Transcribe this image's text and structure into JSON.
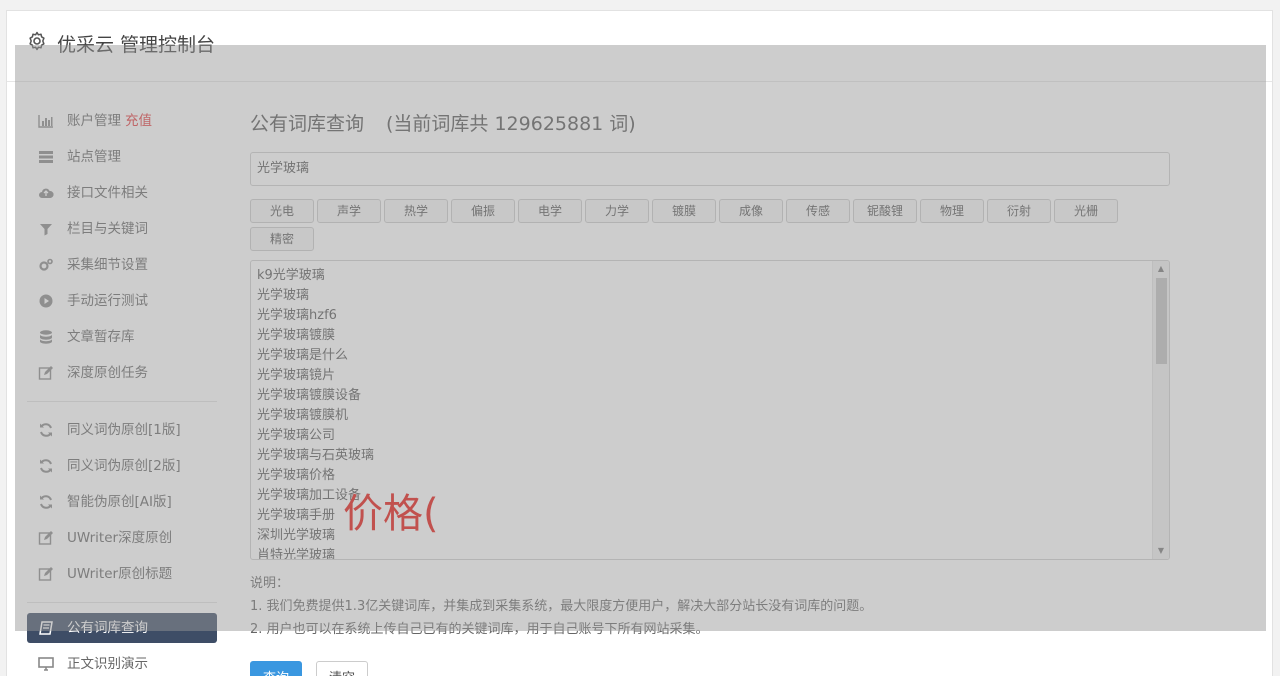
{
  "header": {
    "title": "优采云 管理控制台",
    "icon": "gear-icon"
  },
  "sidebar": {
    "group1": [
      {
        "label": "账户管理",
        "badge": "充值",
        "icon": "bar-chart-icon"
      },
      {
        "label": "站点管理",
        "icon": "server-icon"
      },
      {
        "label": "接口文件相关",
        "icon": "cloud-upload-icon"
      },
      {
        "label": "栏目与关键词",
        "icon": "filter-icon"
      },
      {
        "label": "采集细节设置",
        "icon": "gears-icon"
      },
      {
        "label": "手动运行测试",
        "icon": "play-circle-icon"
      },
      {
        "label": "文章暂存库",
        "icon": "database-icon"
      },
      {
        "label": "深度原创任务",
        "icon": "edit-icon"
      }
    ],
    "group2": [
      {
        "label": "同义词伪原创[1版]",
        "icon": "refresh-icon"
      },
      {
        "label": "同义词伪原创[2版]",
        "icon": "refresh-icon"
      },
      {
        "label": "智能伪原创[AI版]",
        "icon": "refresh-icon"
      },
      {
        "label": "UWriter深度原创",
        "icon": "edit-icon"
      },
      {
        "label": "UWriter原创标题",
        "icon": "edit-icon"
      }
    ],
    "group3": [
      {
        "label": "公有词库查询",
        "icon": "book-icon",
        "active": true
      },
      {
        "label": "正文识别演示",
        "icon": "desktop-icon"
      }
    ]
  },
  "main": {
    "title": "公有词库查询",
    "count_text": "(当前词库共 129625881 词)",
    "search_value": "光学玻璃",
    "tags": [
      "光电",
      "声学",
      "热学",
      "偏振",
      "电学",
      "力学",
      "镀膜",
      "成像",
      "传感",
      "铌酸锂",
      "物理",
      "衍射",
      "光栅",
      "精密"
    ],
    "results": [
      "k9光学玻璃",
      "光学玻璃",
      "光学玻璃hzf6",
      "光学玻璃镀膜",
      "光学玻璃是什么",
      "光学玻璃镜片",
      "光学玻璃镀膜设备",
      "光学玻璃镀膜机",
      "光学玻璃公司",
      "光学玻璃与石英玻璃",
      "光学玻璃价格",
      "光学玻璃加工设备",
      "光学玻璃手册",
      "深圳光学玻璃",
      "肖特光学玻璃"
    ],
    "overlay_text": "价格(",
    "notes": [
      "说明：",
      "1. 我们免费提供1.3亿关键词库，并集成到采集系统，最大限度方便用户，解决大部分站长没有词库的问题。",
      "2. 用户也可以在系统上传自己已有的关键词库，用于自己账号下所有网站采集。"
    ],
    "query_button": "查询",
    "clear_button": "清空"
  },
  "colors": {
    "active_nav_bg": "#3e4d66",
    "primary": "#3a97e0",
    "badge": "#e4393c",
    "overlay_text": "#e8120c"
  }
}
